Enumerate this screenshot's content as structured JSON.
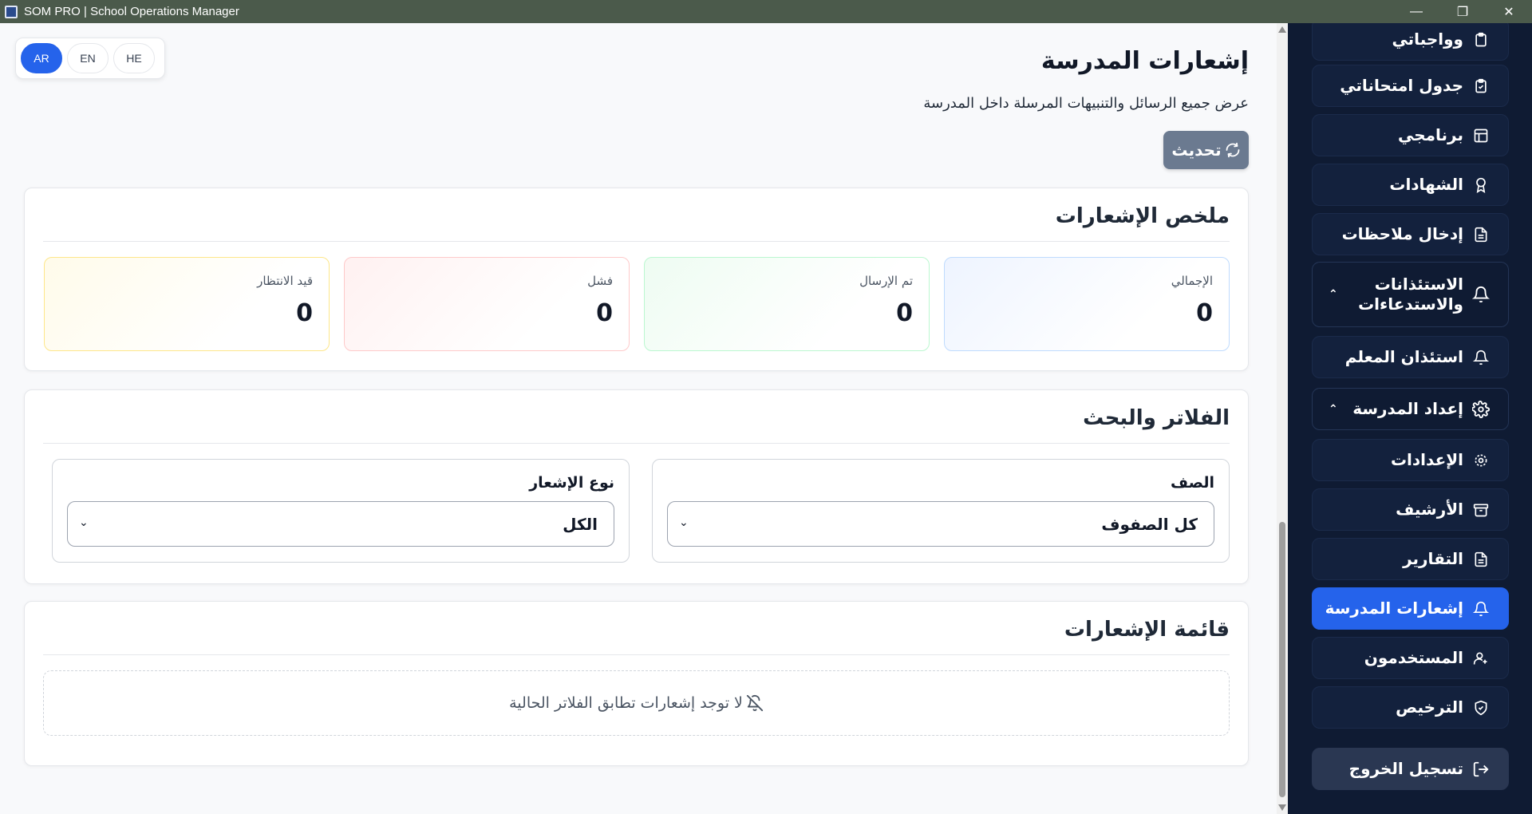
{
  "window": {
    "title": "SOM PRO | School Operations Manager",
    "controls": [
      "minimize",
      "restore",
      "close"
    ]
  },
  "language": {
    "options": [
      "AR",
      "EN",
      "HE"
    ],
    "active": "AR"
  },
  "header": {
    "title": "إشعارات المدرسة",
    "subtitle": "عرض جميع الرسائل والتنبيهات المرسلة داخل المدرسة",
    "refresh_label": "تحديث"
  },
  "summary": {
    "title": "ملخص الإشعارات",
    "stats": {
      "total": {
        "label": "الإجمالي",
        "value": "0"
      },
      "sent": {
        "label": "تم الإرسال",
        "value": "0"
      },
      "failed": {
        "label": "فشل",
        "value": "0"
      },
      "pending": {
        "label": "قيد الانتظار",
        "value": "0"
      }
    }
  },
  "filters": {
    "title": "الفلاتر والبحث",
    "class_filter": {
      "label": "الصف",
      "value": "كل الصفوف"
    },
    "type_filter": {
      "label": "نوع الإشعار",
      "value": "الكل"
    }
  },
  "list": {
    "title": "قائمة الإشعارات",
    "empty_message": "لا توجد إشعارات تطابق الفلاتر الحالية"
  },
  "sidebar": {
    "items": [
      {
        "label": "وواجباتي",
        "icon": "clipboard-icon"
      },
      {
        "label": "جدول امتحاناتي",
        "icon": "clipboard-check-icon"
      },
      {
        "label": "برنامجي",
        "icon": "table-icon"
      },
      {
        "label": "الشهادات",
        "icon": "award-icon"
      },
      {
        "label": "إدخال ملاحظات",
        "icon": "file-text-icon"
      }
    ],
    "group_permissions": {
      "label": "الاستئذانات والاستدعاءات",
      "icon": "bell-icon"
    },
    "teacher_permission": {
      "label": "استئذان المعلم",
      "icon": "bell-icon"
    },
    "group_school_setup": {
      "label": "إعداد المدرسة",
      "icon": "gear-icon"
    },
    "setup_items": [
      {
        "label": "الإعدادات",
        "icon": "gear-icon"
      },
      {
        "label": "الأرشيف",
        "icon": "archive-icon"
      },
      {
        "label": "التقارير",
        "icon": "file-text-icon"
      },
      {
        "label": "إشعارات المدرسة",
        "icon": "bell-icon",
        "active": true
      },
      {
        "label": "المستخدمون",
        "icon": "user-icon"
      },
      {
        "label": "الترخيص",
        "icon": "shield-icon"
      }
    ],
    "logout_label": "تسجيل الخروج"
  },
  "colors": {
    "accent": "#2563eb",
    "sidebar_bg": "#0f1b33",
    "titlebar_bg": "#4b5a4b",
    "refresh_bg": "#6b7a90"
  }
}
